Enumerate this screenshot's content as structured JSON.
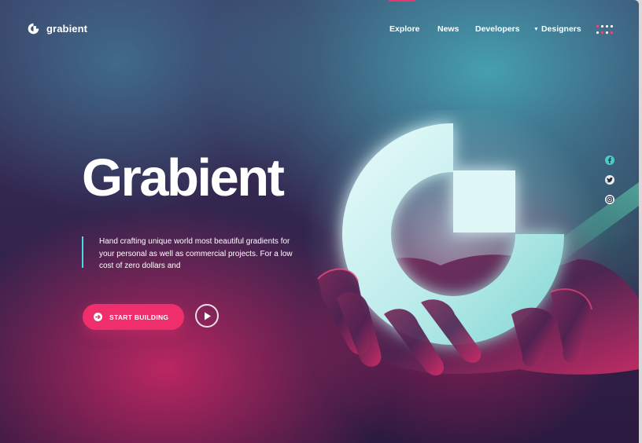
{
  "brand": {
    "name": "grabient",
    "accent": "#ee2f6b",
    "teal": "#49d8e0"
  },
  "nav": {
    "items": [
      {
        "label": "Explore"
      },
      {
        "label": "News"
      },
      {
        "label": "Developers"
      },
      {
        "label": "Designers",
        "has_dropdown": true
      }
    ],
    "menu_icon": "grid-dots-icon"
  },
  "hero": {
    "title": "Grabient",
    "description": "Hand crafting unique world most beautiful gradients for your personal as well as commercial projects. For a low cost of zero dollars and",
    "cta_label": "START BUILDING",
    "cta_icon": "arrow-right-circle-icon",
    "play_icon": "play-icon"
  },
  "social": [
    {
      "name": "facebook-icon"
    },
    {
      "name": "twitter-icon"
    },
    {
      "name": "instagram-icon"
    }
  ],
  "illustration": "glowing-g-logo-held-in-hands"
}
